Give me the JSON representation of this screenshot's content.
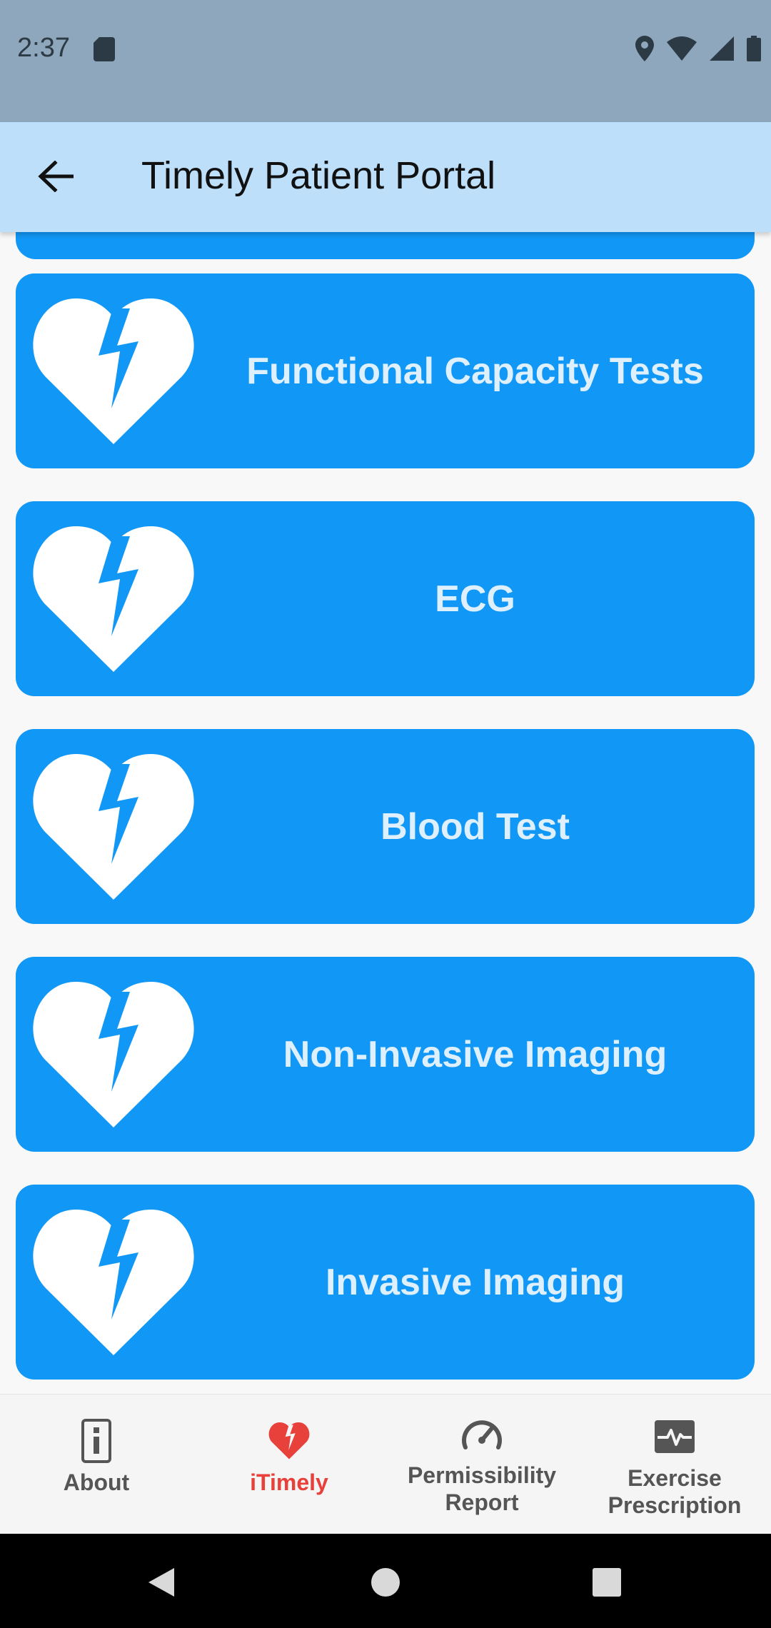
{
  "status_bar": {
    "time": "2:37",
    "icons": [
      "sd-card-icon",
      "location-icon",
      "wifi-icon",
      "signal-icon",
      "battery-icon"
    ]
  },
  "app_bar": {
    "title": "Timely Patient Portal",
    "back_icon": "arrow-left-icon"
  },
  "cards": [
    {
      "label": "Functional Capacity Tests",
      "icon": "broken-heart-icon"
    },
    {
      "label": "ECG",
      "icon": "broken-heart-icon"
    },
    {
      "label": "Blood Test",
      "icon": "broken-heart-icon"
    },
    {
      "label": "Non-Invasive Imaging",
      "icon": "broken-heart-icon"
    },
    {
      "label": "Invasive Imaging",
      "icon": "broken-heart-icon"
    }
  ],
  "bottom_nav": [
    {
      "label": "About",
      "icon": "info-icon",
      "active": false
    },
    {
      "label": "iTimely",
      "icon": "broken-heart-icon",
      "active": true
    },
    {
      "label": "Permissibility Report",
      "icon": "speedometer-icon",
      "active": false
    },
    {
      "label": "Exercise Prescription",
      "icon": "heartbeat-monitor-icon",
      "active": false
    }
  ],
  "system_nav": [
    "back-triangle-icon",
    "home-circle-icon",
    "recents-square-icon"
  ],
  "colors": {
    "status_bar": "#8fa7bc",
    "app_bar": "#bddffa",
    "card": "#1197f6",
    "card_text": "#def0fd",
    "active_nav": "#e8403a",
    "inactive_nav": "#555555"
  }
}
